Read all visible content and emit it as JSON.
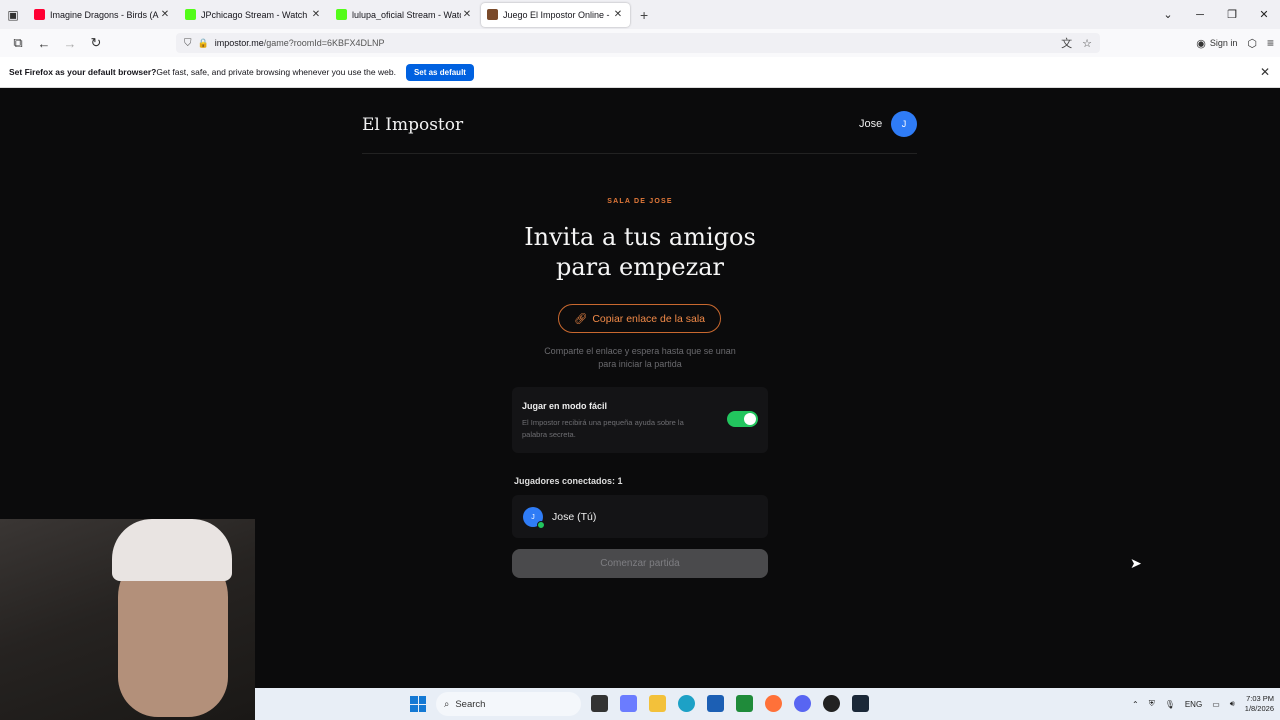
{
  "browser": {
    "tabs": [
      {
        "title": "Imagine Dragons - Birds (Anima",
        "favicon_color": "#ff0033",
        "icon": "youtube-icon",
        "active": false
      },
      {
        "title": "JPchicago Stream - Watch Live o",
        "favicon_color": "#53fc18",
        "icon": "kick-icon",
        "active": false
      },
      {
        "title": "lulupa_oficial Stream - Watch Li",
        "favicon_color": "#53fc18",
        "icon": "kick-icon",
        "active": false
      },
      {
        "title": "Juego El Impostor Online - Jug",
        "favicon_color": "#7a4a2a",
        "icon": "impostor-favicon",
        "active": true
      }
    ],
    "url_host": "impostor.me",
    "url_path": "/game?roomId=6KBFX4DLNP",
    "sign_in_label": "Sign in"
  },
  "notification": {
    "bold_text": "Set Firefox as your default browser?",
    "text": " Get fast, safe, and private browsing whenever you use the web.",
    "button_label": "Set as default"
  },
  "app": {
    "brand": "El Impostor",
    "user_name": "Jose",
    "user_initial": "J",
    "room_label": "SALA DE JOSE",
    "heading_line1": "Invita a tus amigos",
    "heading_line2": "para empezar",
    "copy_button_label": "Copiar enlace de la sala",
    "share_text": "Comparte el enlace y espera hasta que se unan para iniciar la partida",
    "easy_mode": {
      "title": "Jugar en modo fácil",
      "description": "El Impostor recibirá una pequeña ayuda sobre la palabra secreta.",
      "enabled": true
    },
    "players_label": "Jugadores conectados: 1",
    "players": [
      {
        "name": "Jose (Tú)",
        "initial": "J"
      }
    ],
    "start_button_label": "Comenzar partida",
    "accent_color": "#e3793a"
  },
  "taskbar": {
    "search_placeholder": "Search",
    "language": "ENG",
    "time": "7:03 PM",
    "date": "1/8/2026"
  }
}
